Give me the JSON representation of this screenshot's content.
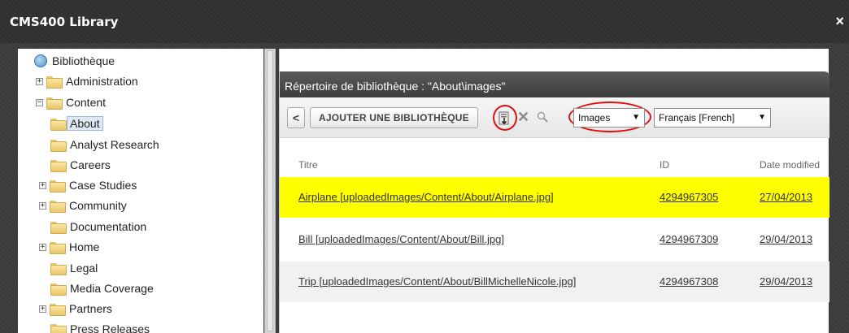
{
  "window": {
    "title": "CMS400 Library",
    "close_label": "×"
  },
  "tree": {
    "root_label": "Bibliothèque",
    "items": [
      {
        "label": "Administration",
        "expander": "+",
        "open": false
      },
      {
        "label": "Content",
        "expander": "−",
        "open": true
      },
      {
        "label": "About",
        "expander": "",
        "selected": true
      },
      {
        "label": "Analyst Research",
        "expander": ""
      },
      {
        "label": "Careers",
        "expander": ""
      },
      {
        "label": "Case Studies",
        "expander": "+"
      },
      {
        "label": "Community",
        "expander": "+"
      },
      {
        "label": "Documentation",
        "expander": ""
      },
      {
        "label": "Home",
        "expander": "+"
      },
      {
        "label": "Legal",
        "expander": ""
      },
      {
        "label": "Media Coverage",
        "expander": ""
      },
      {
        "label": "Partners",
        "expander": "+"
      },
      {
        "label": "Press Releases",
        "expander": ""
      }
    ]
  },
  "panel": {
    "header": "Répertoire de bibliothèque : \"About\\images\"",
    "back_label": "<",
    "add_library_label": "AJOUTER UNE BIBLIOTHÈQUE",
    "type_select": {
      "value": "Images",
      "arrow": "▼"
    },
    "lang_select": {
      "value": "Français [French]",
      "arrow": "▼"
    }
  },
  "table": {
    "columns": [
      "Titre",
      "ID",
      "Date modified"
    ],
    "rows": [
      {
        "title": "Airplane [uploadedImages/Content/About/Airplane.jpg]",
        "id": "4294967305",
        "date": "27/04/2013"
      },
      {
        "title": "Bill [uploadedImages/Content/About/Bill.jpg]",
        "id": "4294967309",
        "date": "29/04/2013"
      },
      {
        "title": "Trip [uploadedImages/Content/About/BillMichelleNicole.jpg]",
        "id": "4294967308",
        "date": "29/04/2013"
      }
    ]
  },
  "colors": {
    "highlight_row": "#ffff00",
    "annotation_ring": "#e01010"
  }
}
